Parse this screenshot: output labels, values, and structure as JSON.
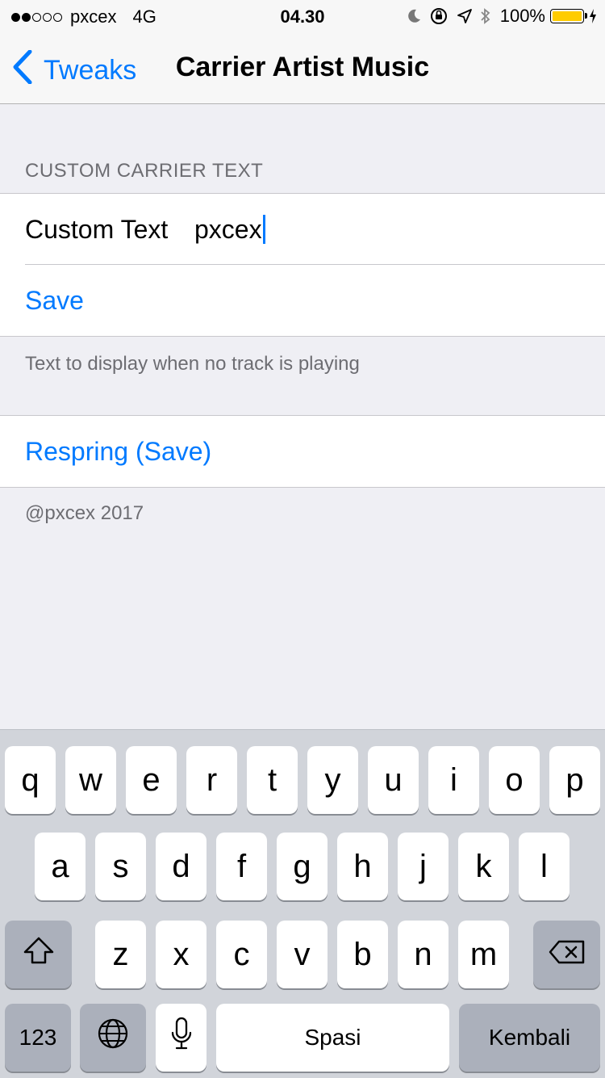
{
  "status_bar": {
    "signal_strength": 2,
    "signal_max": 5,
    "carrier": "pxcex",
    "network": "4G",
    "time": "04.30",
    "icons": [
      "moon-icon",
      "orientation-lock-icon",
      "location-icon",
      "bluetooth-icon"
    ],
    "battery": "100%",
    "battery_level": 1.0,
    "battery_color": "#ffcc00"
  },
  "nav": {
    "back_label": "Tweaks",
    "title": "Carrier Artist Music"
  },
  "section": {
    "header": "CUSTOM CARRIER TEXT",
    "field_label": "Custom Text",
    "field_value": "pxcex",
    "save_label": "Save",
    "footer": "Text to display when no track is playing"
  },
  "respring": {
    "label": "Respring (Save)",
    "footer": "@pxcex 2017"
  },
  "keyboard": {
    "row1": [
      "q",
      "w",
      "e",
      "r",
      "t",
      "y",
      "u",
      "i",
      "o",
      "p"
    ],
    "row2": [
      "a",
      "s",
      "d",
      "f",
      "g",
      "h",
      "j",
      "k",
      "l"
    ],
    "row3": [
      "z",
      "x",
      "c",
      "v",
      "b",
      "n",
      "m"
    ],
    "numbers_label": "123",
    "space_label": "Spasi",
    "return_label": "Kembali",
    "icons": [
      "shift-icon",
      "backspace-icon",
      "globe-icon",
      "microphone-icon"
    ]
  },
  "colors": {
    "accent": "#007aff",
    "background": "#efeff4",
    "keyboard_bg": "#d1d4da"
  }
}
